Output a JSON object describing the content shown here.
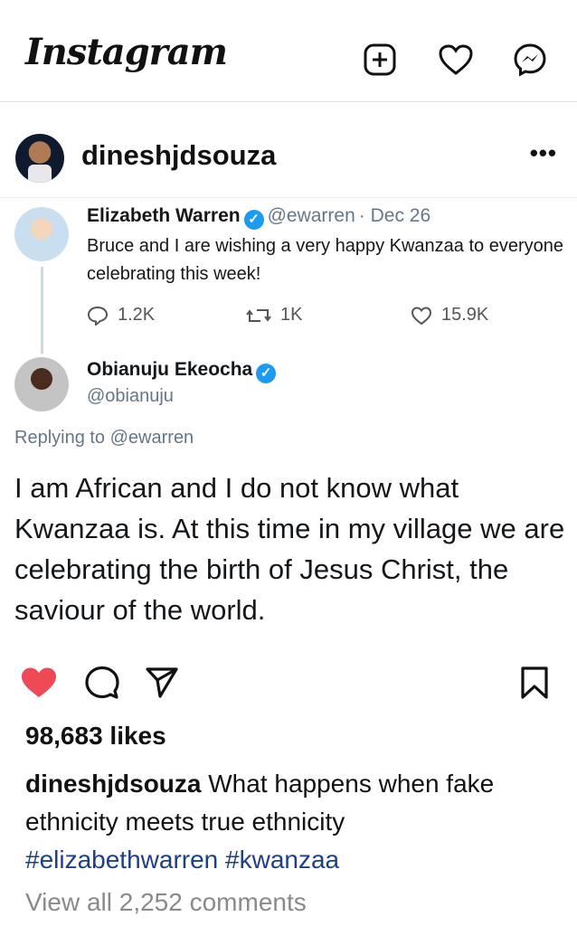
{
  "app": {
    "logo": "Instagram"
  },
  "header_icons": [
    "plus-square-icon",
    "heart-icon",
    "messenger-icon"
  ],
  "post": {
    "username": "dineshjdsouza",
    "more_label": "•••",
    "tweet": {
      "author": {
        "name": "Elizabeth Warren",
        "handle": "@ewarren",
        "date": "· Dec 26",
        "text": "Bruce and I are wishing a very happy Kwanzaa to everyone celebrating this week!",
        "replies": "1.2K",
        "retweets": "1K",
        "likes": "15.9K"
      },
      "reply": {
        "name": "Obianuju Ekeocha",
        "handle": "@obianuju",
        "replying_prefix": "Replying to",
        "replying_to": "@ewarren",
        "text": "I am African and I do not know what Kwanzaa is. At this time in my village we are celebrating the birth of Jesus Christ, the saviour of the world."
      }
    },
    "likes": "98,683 likes",
    "caption": {
      "username": "dineshjdsouza",
      "text": "What happens when fake ethnicity meets true ethnicity",
      "hashtags": [
        "#elizabethwarren",
        "#kwanzaa"
      ]
    },
    "view_comments": "View all 2,252 comments"
  },
  "colors": {
    "like_red": "#ed4956",
    "hashtag_blue": "#1e3f86",
    "verified_blue": "#1d9bf0"
  }
}
